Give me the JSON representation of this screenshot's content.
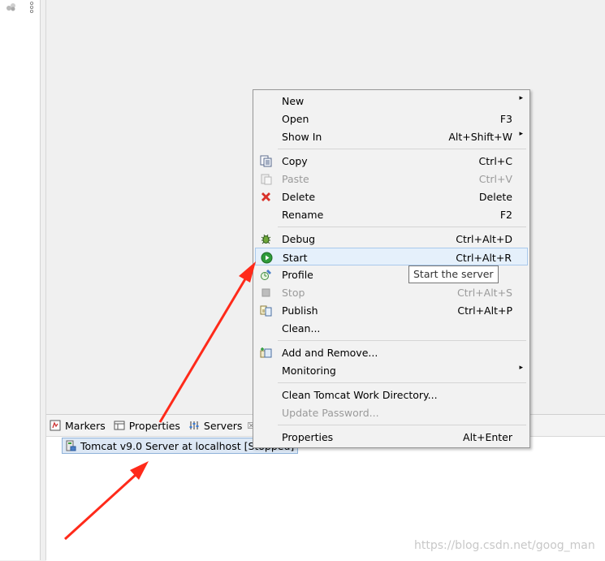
{
  "bottom_tabs": [
    {
      "label": "Markers",
      "icon": "markers-icon"
    },
    {
      "label": "Properties",
      "icon": "properties-icon"
    },
    {
      "label": "Servers",
      "icon": "servers-icon",
      "close": "☒"
    }
  ],
  "server_item": {
    "label": "Tomcat v9.0 Server at localhost  [Stopped]"
  },
  "context_menu": {
    "new": {
      "label": "New",
      "shortcut": "",
      "arrow": "▸"
    },
    "open": {
      "label": "Open",
      "shortcut": "F3"
    },
    "show_in": {
      "label": "Show In",
      "shortcut": "Alt+Shift+W",
      "arrow": "▸"
    },
    "copy": {
      "label": "Copy",
      "shortcut": "Ctrl+C"
    },
    "paste": {
      "label": "Paste",
      "shortcut": "Ctrl+V"
    },
    "delete": {
      "label": "Delete",
      "shortcut": "Delete"
    },
    "rename": {
      "label": "Rename",
      "shortcut": "F2"
    },
    "debug": {
      "label": "Debug",
      "shortcut": "Ctrl+Alt+D"
    },
    "start": {
      "label": "Start",
      "shortcut": "Ctrl+Alt+R"
    },
    "profile": {
      "label": "Profile",
      "shortcut": ""
    },
    "stop": {
      "label": "Stop",
      "shortcut": "Ctrl+Alt+S"
    },
    "publish": {
      "label": "Publish",
      "shortcut": "Ctrl+Alt+P"
    },
    "clean": {
      "label": "Clean...",
      "shortcut": ""
    },
    "add_remove": {
      "label": "Add and Remove...",
      "shortcut": ""
    },
    "monitoring": {
      "label": "Monitoring",
      "shortcut": "",
      "arrow": "▸"
    },
    "clean_tomcat": {
      "label": "Clean Tomcat Work Directory...",
      "shortcut": ""
    },
    "update_password": {
      "label": "Update Password...",
      "shortcut": ""
    },
    "properties": {
      "label": "Properties",
      "shortcut": "Alt+Enter"
    }
  },
  "tooltip": {
    "text": "Start the server"
  },
  "watermark": {
    "text": "https://blog.csdn.net/goog_man"
  },
  "colors": {
    "arrow": "#ff2a1a",
    "delete_icon": "#d9322a",
    "start_icon": "#2e9b3a",
    "highlight": "#e5f0fb"
  }
}
